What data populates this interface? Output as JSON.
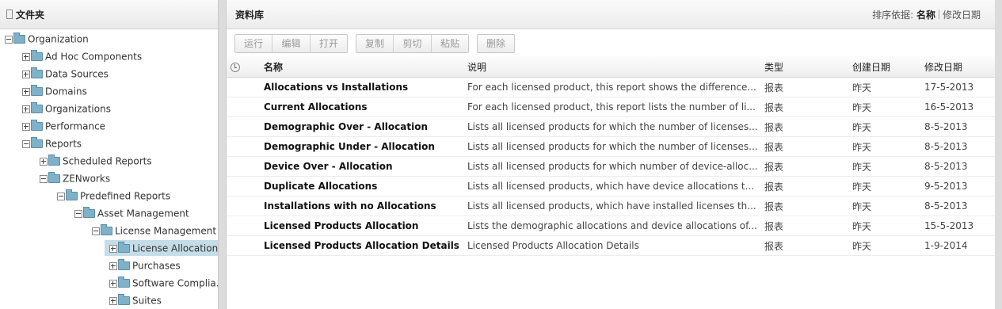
{
  "folders": {
    "title": "文件夹",
    "nodes": [
      {
        "label": "Organization",
        "toggle": "minus",
        "selected": false
      },
      {
        "label": "Ad Hoc Components",
        "toggle": "plus",
        "selected": false
      },
      {
        "label": "Data Sources",
        "toggle": "plus",
        "selected": false
      },
      {
        "label": "Domains",
        "toggle": "plus",
        "selected": false
      },
      {
        "label": "Organizations",
        "toggle": "plus",
        "selected": false
      },
      {
        "label": "Performance",
        "toggle": "plus",
        "selected": false
      },
      {
        "label": "Reports",
        "toggle": "minus",
        "selected": false
      },
      {
        "label": "Scheduled Reports",
        "toggle": "plus",
        "selected": false
      },
      {
        "label": "ZENworks",
        "toggle": "minus",
        "selected": false
      },
      {
        "label": "Predefined Reports",
        "toggle": "minus",
        "selected": false
      },
      {
        "label": "Asset Management",
        "toggle": "minus",
        "selected": false
      },
      {
        "label": "License Management",
        "toggle": "minus",
        "selected": false
      },
      {
        "label": "License Allocation",
        "toggle": "plus",
        "selected": true
      },
      {
        "label": "Purchases",
        "toggle": "plus",
        "selected": false
      },
      {
        "label": "Software Complia...",
        "toggle": "plus",
        "selected": false
      },
      {
        "label": "Suites",
        "toggle": "plus",
        "selected": false
      }
    ]
  },
  "library": {
    "title": "资料库",
    "sort_label": "排序依据:",
    "sort_name": "名称",
    "sort_modified": "修改日期"
  },
  "toolbar": {
    "group1": [
      "运行",
      "编辑",
      "打开"
    ],
    "group2": [
      "复制",
      "剪切",
      "粘贴"
    ],
    "group3": [
      "删除"
    ]
  },
  "table": {
    "columns": {
      "name": "名称",
      "desc": "说明",
      "type": "类型",
      "created": "创建日期",
      "modified": "修改日期"
    },
    "rows": [
      {
        "name": "Allocations vs Installations",
        "desc": "For each licensed product, this report shows the difference...",
        "type": "报表",
        "created": "昨天",
        "modified": "17-5-2013"
      },
      {
        "name": "Current Allocations",
        "desc": "For each licensed product, this report lists the number of li...",
        "type": "报表",
        "created": "昨天",
        "modified": "16-5-2013"
      },
      {
        "name": "Demographic Over - Allocation",
        "desc": "Lists all licensed products for which the number of licenses...",
        "type": "报表",
        "created": "昨天",
        "modified": "8-5-2013"
      },
      {
        "name": "Demographic Under - Allocation",
        "desc": "Lists all licensed products for which the number of licenses...",
        "type": "报表",
        "created": "昨天",
        "modified": "8-5-2013"
      },
      {
        "name": "Device Over - Allocation",
        "desc": "Lists all licensed products for which number of device-alloc...",
        "type": "报表",
        "created": "昨天",
        "modified": "8-5-2013"
      },
      {
        "name": "Duplicate Allocations",
        "desc": "Lists all licensed products, which have device allocations t...",
        "type": "报表",
        "created": "昨天",
        "modified": "9-5-2013"
      },
      {
        "name": "Installations with no Allocations",
        "desc": "Lists all licensed products, which have installed licenses th...",
        "type": "报表",
        "created": "昨天",
        "modified": "8-5-2013"
      },
      {
        "name": "Licensed Products Allocation",
        "desc": "Lists the demographic allocations and device allocations of...",
        "type": "报表",
        "created": "昨天",
        "modified": "15-5-2013"
      },
      {
        "name": "Licensed Products Allocation Details",
        "desc": "Licensed Products Allocation Details",
        "type": "报表",
        "created": "昨天",
        "modified": "1-9-2014"
      }
    ]
  }
}
